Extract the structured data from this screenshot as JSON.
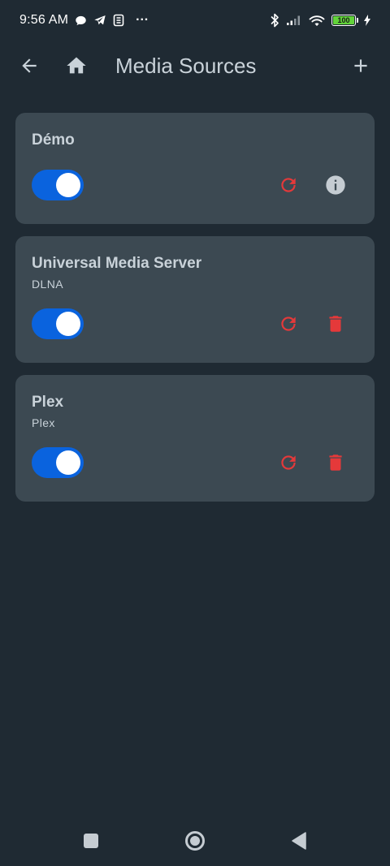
{
  "status_bar": {
    "time": "9:56 AM",
    "more": "···",
    "battery": "100"
  },
  "app_bar": {
    "title": "Media Sources"
  },
  "sources": [
    {
      "title": "Démo",
      "subtitle": "",
      "enabled": true
    },
    {
      "title": "Universal Media Server",
      "subtitle": "DLNA",
      "enabled": true
    },
    {
      "title": "Plex",
      "subtitle": "Plex",
      "enabled": true
    }
  ],
  "colors": {
    "background": "#1f2a33",
    "card": "#3c4952",
    "toggle_on": "#0a63de",
    "danger": "#e5393a",
    "text": "#c9d2d9",
    "info": "#c5ccd2"
  }
}
